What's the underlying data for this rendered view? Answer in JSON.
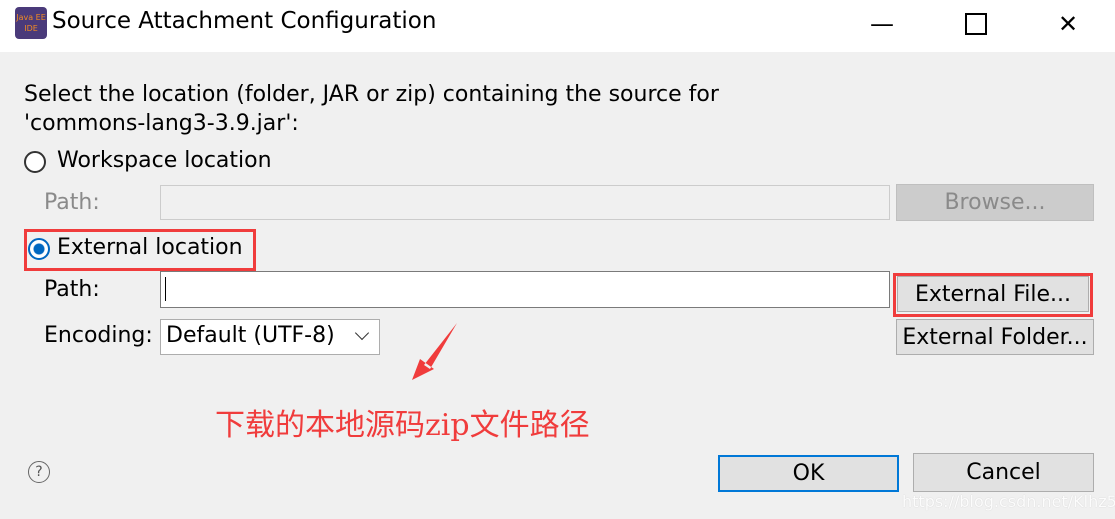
{
  "window": {
    "title": "Source Attachment Configuration",
    "app_icon": "java-ee-ide-icon",
    "icon_text": "Java EE IDE"
  },
  "prompt": {
    "line1": "Select the location (folder, JAR or zip) containing the source for",
    "line2": "'commons-lang3-3.9.jar':"
  },
  "workspace": {
    "label": "Workspace location",
    "selected": false,
    "path_label": "Path:",
    "path_value": "",
    "browse": "Browse..."
  },
  "external": {
    "label": "External location",
    "selected": true,
    "path_label": "Path:",
    "path_value": "",
    "file_button": "External File...",
    "encoding_label": "Encoding:",
    "encoding_value": "Default (UTF-8)",
    "folder_button": "External Folder..."
  },
  "annotation": {
    "text": "下载的本地源码zip文件路径",
    "color": "#f03c3c"
  },
  "buttons": {
    "ok": "OK",
    "cancel": "Cancel"
  },
  "watermark": "https://blog.csdn.net/Klhz555"
}
